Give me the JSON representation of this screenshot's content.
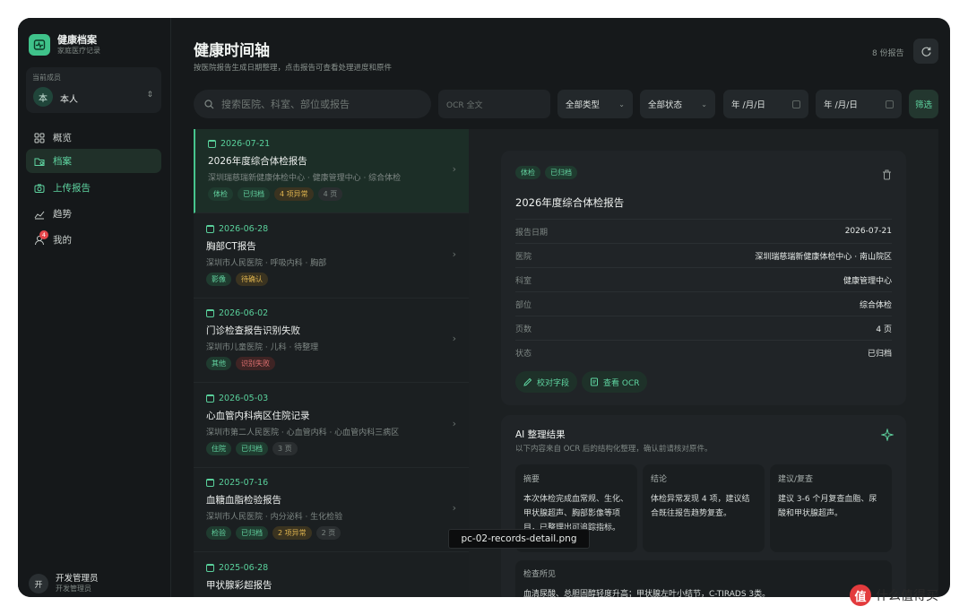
{
  "brand": {
    "title": "健康档案",
    "subtitle": "家庭医疗记录"
  },
  "member": {
    "label": "当前成员",
    "avatar": "本",
    "name": "本人"
  },
  "nav": [
    {
      "label": "概览",
      "icon": "grid-icon"
    },
    {
      "label": "档案",
      "icon": "folder-icon"
    },
    {
      "label": "上传报告",
      "icon": "camera-icon"
    },
    {
      "label": "趋势",
      "icon": "chart-icon"
    },
    {
      "label": "我的",
      "icon": "user-icon",
      "badge": "4"
    }
  ],
  "admin": {
    "avatar": "开",
    "name": "开发管理员",
    "sub": "开发管理员"
  },
  "header": {
    "title": "健康时间轴",
    "subtitle": "按医院报告生成日期整理，点击报告可查看处理进度和原件",
    "count": "8 份报告"
  },
  "filters": {
    "search_placeholder": "搜索医院、科室、部位或报告",
    "ocr_placeholder": "OCR 全文",
    "type": "全部类型",
    "status": "全部状态",
    "date_from": "年 /月/日",
    "date_to": "年 /月/日",
    "filter_btn": "筛选"
  },
  "records": [
    {
      "date": "2026-07-21",
      "title": "2026年度综合体检报告",
      "meta": "深圳瑞慈瑞新健康体检中心 · 健康管理中心 · 综合体检",
      "tags": [
        [
          "体检",
          "green"
        ],
        [
          "已归档",
          "green"
        ],
        [
          "4 项异常",
          "gold"
        ],
        [
          "4 页",
          "gray"
        ]
      ]
    },
    {
      "date": "2026-06-28",
      "title": "胸部CT报告",
      "meta": "深圳市人民医院 · 呼吸内科 · 胸部",
      "tags": [
        [
          "影像",
          "green"
        ],
        [
          "待确认",
          "gold"
        ]
      ]
    },
    {
      "date": "2026-06-02",
      "title": "门诊检查报告识别失败",
      "meta": "深圳市儿童医院 · 儿科 · 待整理",
      "tags": [
        [
          "其他",
          "green"
        ],
        [
          "识别失败",
          "red"
        ]
      ]
    },
    {
      "date": "2026-05-03",
      "title": "心血管内科病区住院记录",
      "meta": "深圳市第二人民医院 · 心血管内科 · 心血管内科三病区",
      "tags": [
        [
          "住院",
          "green"
        ],
        [
          "已归档",
          "green"
        ],
        [
          "3 页",
          "gray"
        ]
      ]
    },
    {
      "date": "2025-07-16",
      "title": "血糖血脂检验报告",
      "meta": "深圳市人民医院 · 内分泌科 · 生化检验",
      "tags": [
        [
          "检验",
          "green"
        ],
        [
          "已归档",
          "green"
        ],
        [
          "2 项异常",
          "gold"
        ],
        [
          "2 页",
          "gray"
        ]
      ]
    },
    {
      "date": "2025-06-28",
      "title": "甲状腺彩超报告",
      "meta": "",
      "tags": []
    }
  ],
  "detail": {
    "tags": [
      [
        "体检",
        "green"
      ],
      [
        "已归档",
        "green"
      ]
    ],
    "title": "2026年度综合体检报告",
    "rows": [
      {
        "k": "报告日期",
        "v": "2026-07-21"
      },
      {
        "k": "医院",
        "v": "深圳瑞慈瑞新健康体检中心 · 南山院区"
      },
      {
        "k": "科室",
        "v": "健康管理中心"
      },
      {
        "k": "部位",
        "v": "综合体检"
      },
      {
        "k": "页数",
        "v": "4 页"
      },
      {
        "k": "状态",
        "v": "已归档"
      }
    ],
    "btn_verify": "校对字段",
    "btn_ocr": "查看 OCR"
  },
  "ai": {
    "title": "AI 整理结果",
    "subtitle": "以下内容来自 OCR 后的结构化整理，确认前请核对原件。",
    "summary_title": "摘要",
    "summary_body": "本次体检完成血常规、生化、甲状腺超声、胸部影像等项目，已整理出可追踪指标。",
    "conclusion_title": "结论",
    "conclusion_body": "体检异常发现 4 项，建议结合既往报告趋势复查。",
    "advice_title": "建议/复查",
    "advice_body": "建议 3-6 个月复查血脂、尿酸和甲状腺超声。",
    "findings_title": "检查所见",
    "findings_body": "血清尿酸、总胆固醇轻度升高；甲状腺左叶小结节，C-TIRADS 3类。"
  },
  "tooltip": "pc-02-records-detail.png",
  "watermark": {
    "logo": "值",
    "text": "什么值得买"
  }
}
